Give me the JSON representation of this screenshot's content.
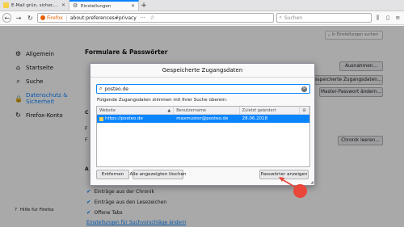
{
  "tabs": [
    {
      "label": "E-Mail grün, sicher, einfach un...",
      "active": false
    },
    {
      "label": "Einstellungen",
      "active": true
    }
  ],
  "new_tab": "+",
  "nav": {
    "back": "←",
    "forward": "→",
    "reload": "↻",
    "brand": "Firefox",
    "url": "about:preferences#privacy",
    "search_placeholder": "Suchen"
  },
  "prefs": {
    "search_placeholder": "In Einstellungen suchen",
    "sidebar": [
      {
        "label": "Allgemein",
        "icon": "gear-icon",
        "glyph": "⚙",
        "active": false
      },
      {
        "label": "Startseite",
        "icon": "home-icon",
        "glyph": "⌂",
        "active": false
      },
      {
        "label": "Suche",
        "icon": "search-icon",
        "glyph": "🔍",
        "active": false
      },
      {
        "label": "Datenschutz & Sicherheit",
        "icon": "lock-icon",
        "glyph": "🔒",
        "active": true
      },
      {
        "label": "Firefox-Konto",
        "icon": "sync-icon",
        "glyph": "↻",
        "active": false
      }
    ],
    "help": "Hilfe für Firefox",
    "section_title": "Formulare & Passwörter",
    "btn_exceptions": "Ausnahmen...",
    "btn_saved": "Gespeicherte Zugangsdaten...",
    "btn_master": "Master-Passwort ändern...",
    "btn_clear": "Chronik leeren...",
    "frag_c": "C",
    "frag_f1": "F",
    "frag_f2": "F",
    "frag_a": "A",
    "history_items": [
      "Einträge aus der Chronik",
      "Einträge aus den Lesezeichen",
      "Offene Tabs"
    ],
    "link_suggestions": "Einstellungen für Suchvorschläge ändern"
  },
  "dialog": {
    "title": "Gespeicherte Zugangsdaten",
    "search_value": "posteo.de",
    "note": "Folgende Zugangsdaten stimmen mit Ihrer Suche überein:",
    "columns": [
      "Website",
      "Benutzername",
      "Zuletzt geändert"
    ],
    "rows": [
      {
        "website": "https://posteo.de",
        "username": "maxmuster@posteo.de",
        "changed": "28.06.2018"
      }
    ],
    "btn_remove": "Entfernen",
    "btn_remove_all": "Alle angezeigten löschen",
    "btn_show_passwords": "Passwörter anzeigen"
  },
  "colors": {
    "accent": "#0a84ff",
    "marker": "#e8473a"
  }
}
